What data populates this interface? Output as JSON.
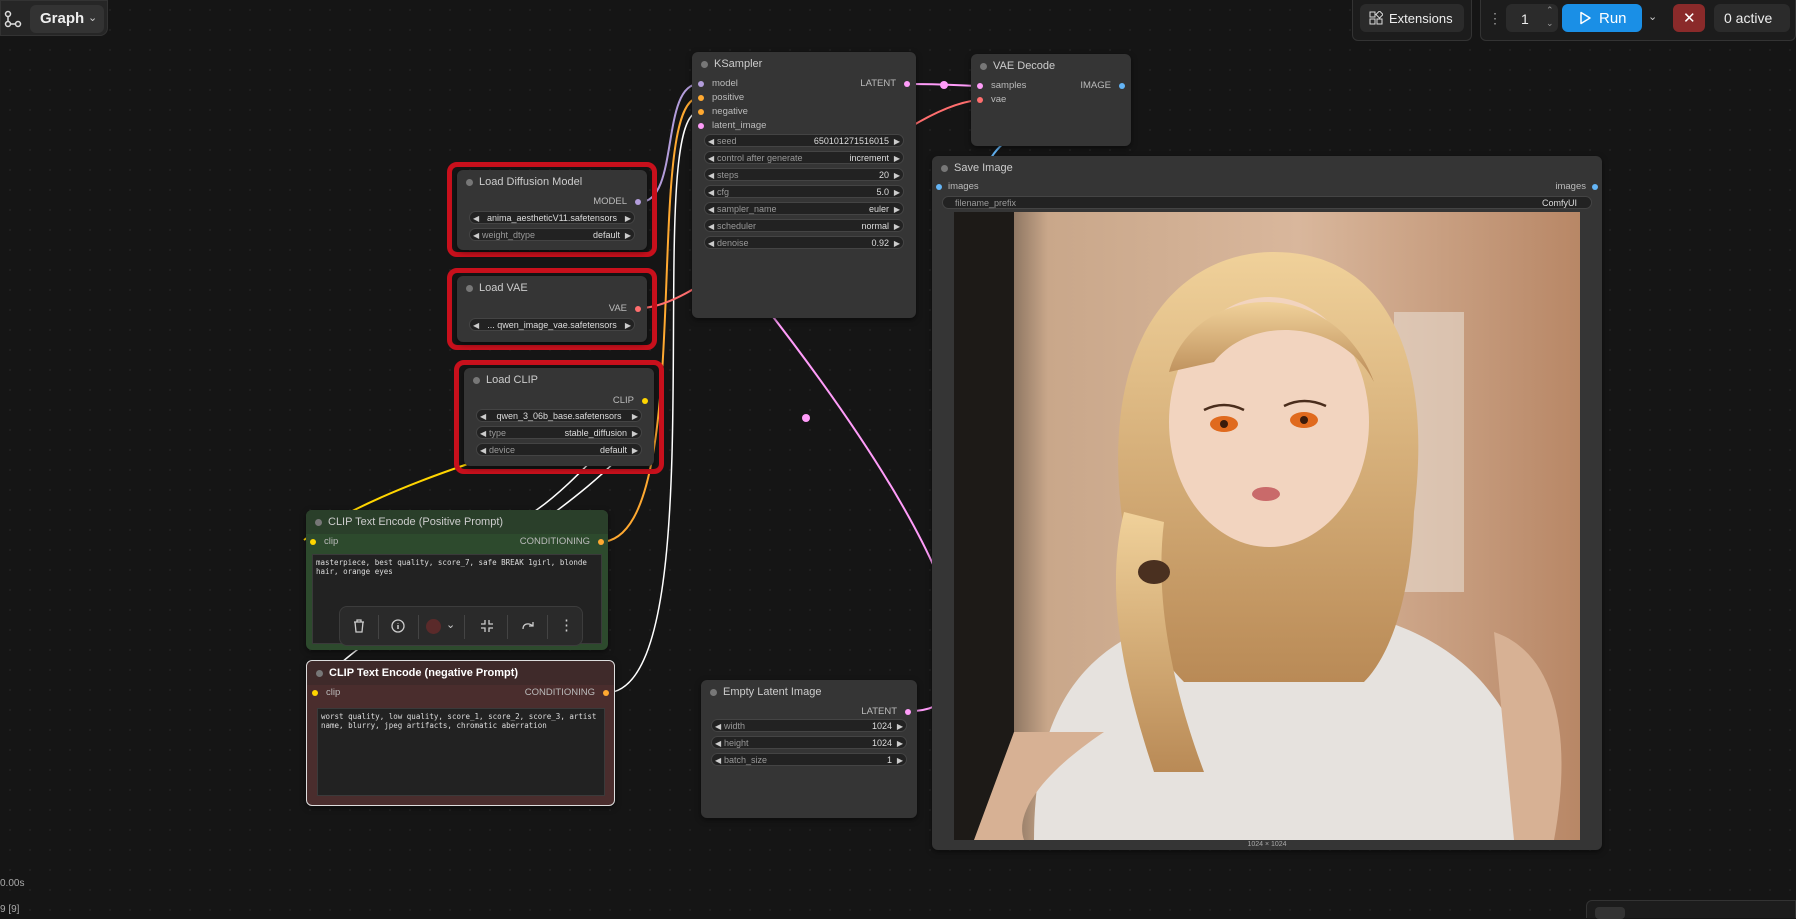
{
  "topbar": {
    "graph_label": "Graph",
    "extensions_label": "Extensions",
    "queue_count": "1",
    "run_label": "Run",
    "active_label": "0 active"
  },
  "nodes": {
    "ksampler": {
      "title": "KSampler",
      "inputs": [
        "model",
        "positive",
        "negative",
        "latent_image"
      ],
      "output": "LATENT",
      "widgets": [
        {
          "label": "seed",
          "value": "650101271516015"
        },
        {
          "label": "control after generate",
          "value": "increment"
        },
        {
          "label": "steps",
          "value": "20"
        },
        {
          "label": "cfg",
          "value": "5.0"
        },
        {
          "label": "sampler_name",
          "value": "euler"
        },
        {
          "label": "scheduler",
          "value": "normal"
        },
        {
          "label": "denoise",
          "value": "0.92"
        }
      ]
    },
    "vae_decode": {
      "title": "VAE Decode",
      "inputs": [
        "samples",
        "vae"
      ],
      "output": "IMAGE"
    },
    "save_image": {
      "title": "Save Image",
      "input": "images",
      "output": "images",
      "filename_label": "filename_prefix",
      "filename_value": "ComfyUI",
      "caption": "1024 × 1024"
    },
    "load_diffusion": {
      "title": "Load Diffusion Model",
      "output": "MODEL",
      "model_value": "anima_aestheticV11.safetensors",
      "weight_label": "weight_dtype",
      "weight_value": "default"
    },
    "load_vae": {
      "title": "Load VAE",
      "output": "VAE",
      "vae_value": "... qwen_image_vae.safetensors"
    },
    "load_clip": {
      "title": "Load CLIP",
      "output": "CLIP",
      "clip_value": "qwen_3_06b_base.safetensors",
      "type_label": "type",
      "type_value": "stable_diffusion",
      "device_label": "device",
      "device_value": "default"
    },
    "clip_pos": {
      "title": "CLIP Text Encode (Positive Prompt)",
      "input": "clip",
      "output": "CONDITIONING",
      "text": "masterpiece, best quality, score_7, safe BREAK 1girl, blonde hair, orange eyes"
    },
    "clip_neg": {
      "title": "CLIP Text Encode (negative Prompt)",
      "input": "clip",
      "output": "CONDITIONING",
      "text": "worst quality, low quality, score_1, score_2, score_3, artist name, blurry, jpeg artifacts, chromatic aberration"
    },
    "empty_latent": {
      "title": "Empty Latent Image",
      "output": "LATENT",
      "widgets": [
        {
          "label": "width",
          "value": "1024"
        },
        {
          "label": "height",
          "value": "1024"
        },
        {
          "label": "batch_size",
          "value": "1"
        }
      ]
    }
  },
  "stats": {
    "time": "0.00s",
    "line2": "9 [9]"
  },
  "colors": {
    "accent": "#1a8fe6",
    "stop": "#8a2a2a",
    "highlight": "#c8101c",
    "pos_node": "#2d4a2d",
    "neg_node": "#4a2d2d",
    "model_link": "#b39ddb",
    "clip_link": "#ffd500",
    "cond_link": "#ffa931",
    "latent_link": "#ff9cf9",
    "vae_link": "#ff6e6e",
    "image_link": "#64b5f6"
  },
  "icons": [
    "graph-app-icon",
    "chevron-down-icon",
    "puzzle-icon",
    "drag-handle-icon",
    "play-icon",
    "close-icon",
    "trash-icon",
    "info-icon",
    "color-dot-icon",
    "collapse-icon",
    "redo-icon",
    "more-icon"
  ]
}
